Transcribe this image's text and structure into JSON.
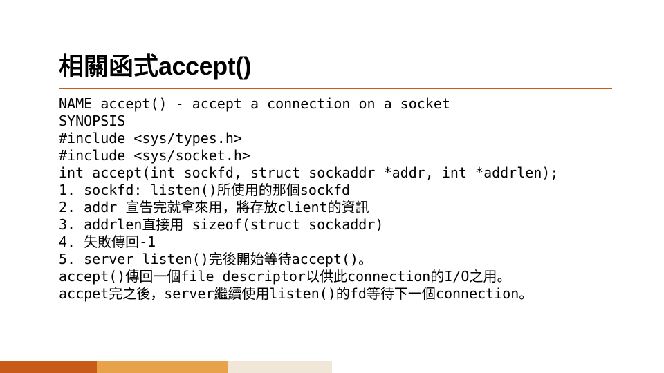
{
  "title": {
    "prefix_cjk": "相關函式",
    "latin": "accept()"
  },
  "lines": {
    "name": "NAME accept() - accept a connection on a socket",
    "synopsis": "SYNOPSIS",
    "include1": "#include <sys/types.h>",
    "include2": "#include <sys/socket.h>",
    "proto": "int accept(int sockfd, struct sockaddr *addr, int *addrlen);",
    "li1": "1. sockfd: listen()所使用的那個sockfd",
    "li2": "2. addr 宣告完就拿來用，將存放client的資訊",
    "li3": "3. addrlen直接用 sizeof(struct sockaddr)",
    "li4": "4.  失敗傳回-1",
    "li5": "5. server listen()完後開始等待accept()。",
    "p1": "accept()傳回一個file descriptor以供此connection的I/O之用。",
    "p2": "accpet完之後，server繼續使用listen()的fd等待下一個connection。"
  },
  "colors": {
    "accent": "#c85a1a",
    "bar2": "#e8a24a",
    "bar3": "#f0e7d8"
  }
}
